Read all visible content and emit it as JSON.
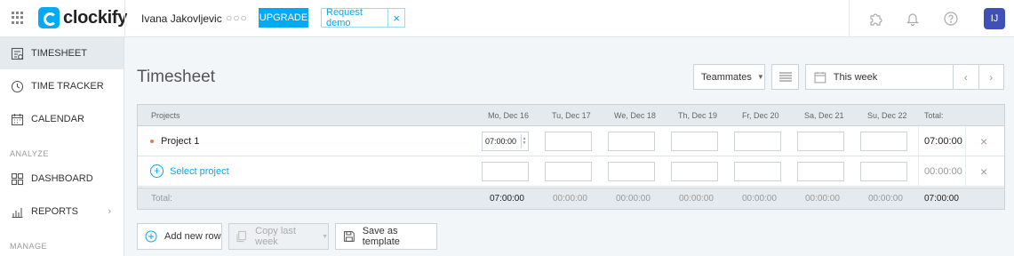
{
  "header": {
    "logo_text": "clockify",
    "workspace_name": "Ivana Jakovljevic",
    "more_dots": "○○○",
    "upgrade_label": "UPGRADE",
    "request_demo_label": "Request demo",
    "request_demo_close": "×",
    "avatar_initials": "IJ",
    "brand_color": "#03a9f4",
    "avatar_color": "#3f51b5"
  },
  "sidebar": {
    "items": [
      {
        "label": "TIMESHEET",
        "icon": "timesheet-icon",
        "active": true
      },
      {
        "label": "TIME TRACKER",
        "icon": "clock-icon"
      },
      {
        "label": "CALENDAR",
        "icon": "calendar-icon"
      }
    ],
    "section_analyze": "ANALYZE",
    "analyze_items": [
      {
        "label": "DASHBOARD",
        "icon": "dashboard-icon"
      },
      {
        "label": "REPORTS",
        "icon": "reports-icon",
        "chevron": "›"
      }
    ],
    "section_manage": "MANAGE"
  },
  "main": {
    "title": "Timesheet",
    "teammates_label": "Teammates",
    "week_label": "This week",
    "prev": "‹",
    "next": "›"
  },
  "table": {
    "headers": {
      "projects": "Projects",
      "days": [
        "Mo, Dec 16",
        "Tu, Dec 17",
        "We, Dec 18",
        "Th, Dec 19",
        "Fr, Dec 20",
        "Sa, Dec 21",
        "Su, Dec 22"
      ],
      "total": "Total:"
    },
    "rows": [
      {
        "project": "Project 1",
        "project_color": "#ef7b4a",
        "mon_value": "07:00:00",
        "total": "07:00:00",
        "remove": "×"
      },
      {
        "select_label": "Select project",
        "total": "00:00:00",
        "remove": "×"
      }
    ],
    "footer": {
      "label": "Total:",
      "days": [
        "07:00:00",
        "00:00:00",
        "00:00:00",
        "00:00:00",
        "00:00:00",
        "00:00:00",
        "00:00:00"
      ],
      "total": "07:00:00"
    }
  },
  "actions": {
    "add_row": "Add new row",
    "copy_last_week": "Copy last week",
    "save_template": "Save as template"
  }
}
